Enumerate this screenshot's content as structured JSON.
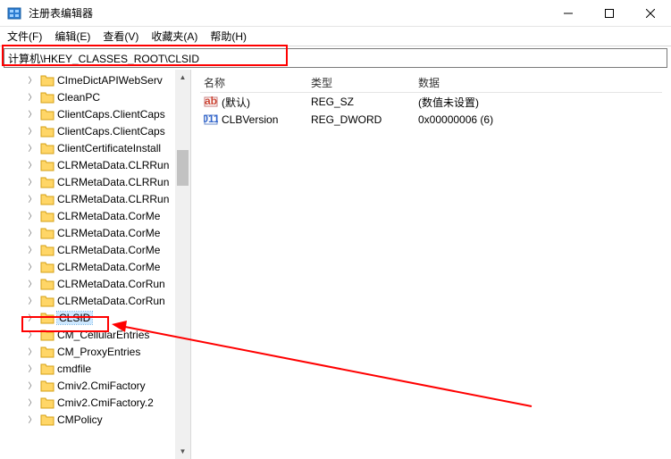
{
  "window": {
    "title": "注册表编辑器"
  },
  "menubar": {
    "file": "文件(F)",
    "edit": "编辑(E)",
    "view": "查看(V)",
    "favorites": "收藏夹(A)",
    "help": "帮助(H)"
  },
  "addressbar": {
    "path": "计算机\\HKEY_CLASSES_ROOT\\CLSID"
  },
  "tree": {
    "items": [
      {
        "label": "CImeDictAPIWebServ",
        "selected": false
      },
      {
        "label": "CleanPC",
        "selected": false
      },
      {
        "label": "ClientCaps.ClientCaps",
        "selected": false
      },
      {
        "label": "ClientCaps.ClientCaps",
        "selected": false
      },
      {
        "label": "ClientCertificateInstall",
        "selected": false
      },
      {
        "label": "CLRMetaData.CLRRun",
        "selected": false
      },
      {
        "label": "CLRMetaData.CLRRun",
        "selected": false
      },
      {
        "label": "CLRMetaData.CLRRun",
        "selected": false
      },
      {
        "label": "CLRMetaData.CorMe",
        "selected": false
      },
      {
        "label": "CLRMetaData.CorMe",
        "selected": false
      },
      {
        "label": "CLRMetaData.CorMe",
        "selected": false
      },
      {
        "label": "CLRMetaData.CorMe",
        "selected": false
      },
      {
        "label": "CLRMetaData.CorRun",
        "selected": false
      },
      {
        "label": "CLRMetaData.CorRun",
        "selected": false
      },
      {
        "label": "CLSID",
        "selected": true
      },
      {
        "label": "CM_CellularEntries",
        "selected": false
      },
      {
        "label": "CM_ProxyEntries",
        "selected": false
      },
      {
        "label": "cmdfile",
        "selected": false
      },
      {
        "label": "Cmiv2.CmiFactory",
        "selected": false
      },
      {
        "label": "Cmiv2.CmiFactory.2",
        "selected": false
      },
      {
        "label": "CMPolicy",
        "selected": false
      }
    ]
  },
  "list": {
    "headers": {
      "name": "名称",
      "type": "类型",
      "data": "数据"
    },
    "rows": [
      {
        "icon": "string",
        "name": "(默认)",
        "type": "REG_SZ",
        "data": "(数值未设置)"
      },
      {
        "icon": "binary",
        "name": "CLBVersion",
        "type": "REG_DWORD",
        "data": "0x00000006 (6)"
      }
    ]
  }
}
